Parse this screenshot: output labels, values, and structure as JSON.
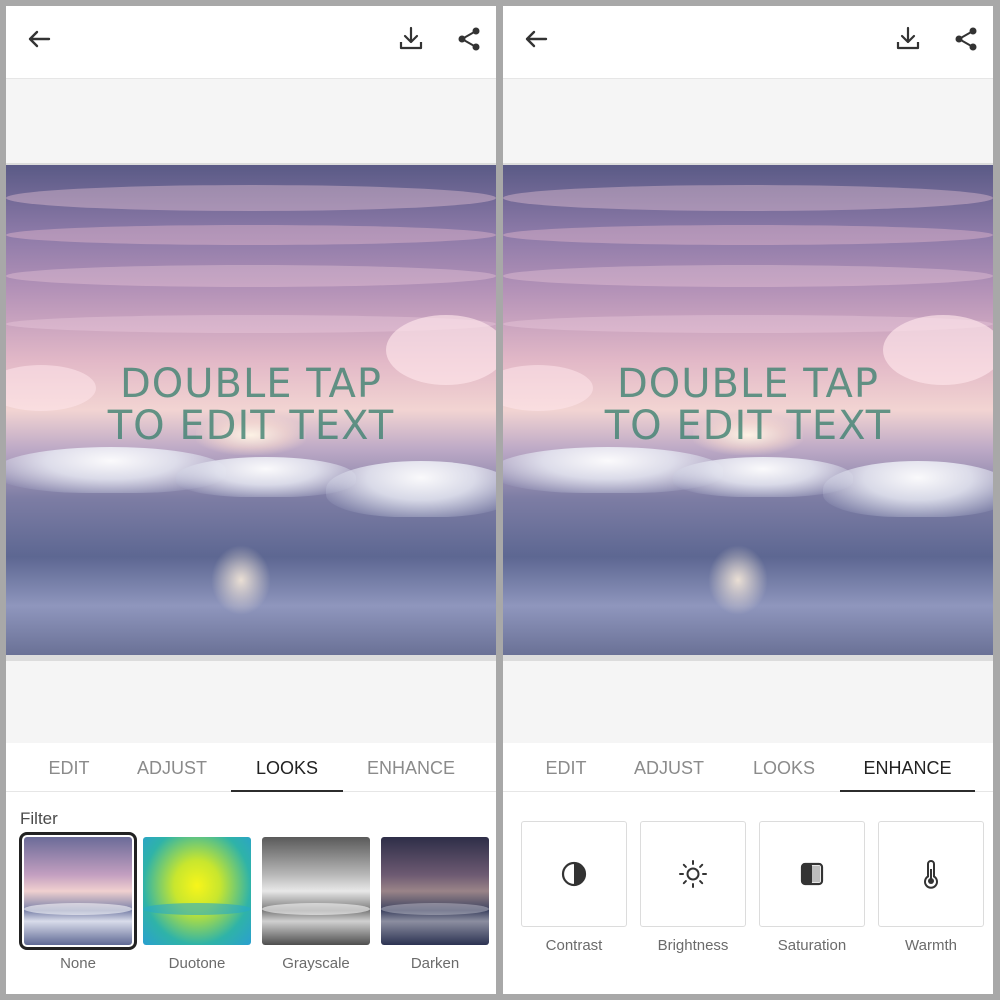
{
  "overlay_text": {
    "line1": "DOUBLE TAP",
    "line2": "TO EDIT TEXT"
  },
  "tabs": [
    {
      "label": "EDIT"
    },
    {
      "label": "ADJUST"
    },
    {
      "label": "LOOKS"
    },
    {
      "label": "ENHANCE"
    }
  ],
  "left_panel": {
    "active_tab": "LOOKS",
    "filter_section_label": "Filter",
    "filters": [
      {
        "label": "None",
        "selected": true
      },
      {
        "label": "Duotone",
        "selected": false
      },
      {
        "label": "Grayscale",
        "selected": false
      },
      {
        "label": "Darken",
        "selected": false
      }
    ]
  },
  "right_panel": {
    "active_tab": "ENHANCE",
    "enhance_options": [
      {
        "label": "Contrast",
        "icon": "contrast-icon"
      },
      {
        "label": "Brightness",
        "icon": "brightness-icon"
      },
      {
        "label": "Saturation",
        "icon": "saturation-icon"
      },
      {
        "label": "Warmth",
        "icon": "thermometer-icon"
      }
    ]
  },
  "toolbar_icons": [
    "back-arrow-icon",
    "download-icon",
    "share-icon"
  ],
  "colors": {
    "overlay_text": "#3a806e",
    "active_tab": "#222222",
    "inactive_tab": "#8b8b8b"
  }
}
